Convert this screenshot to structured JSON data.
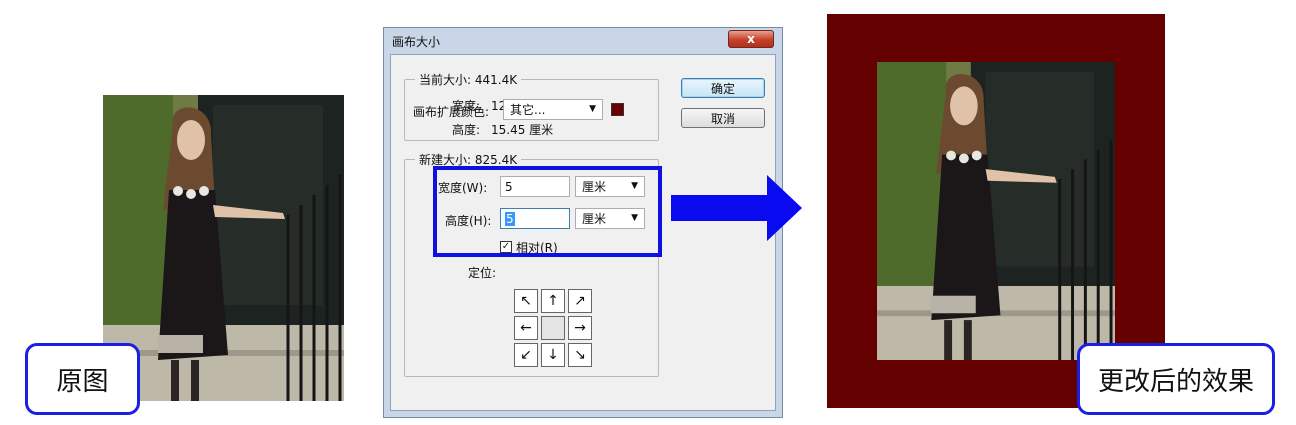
{
  "captions": {
    "original": "原图",
    "result": "更改后的效果"
  },
  "dialog": {
    "title": "画布大小",
    "close_symbol": "x",
    "current_size": {
      "legend": "当前大小: 441.4K",
      "width_label": "宽度:",
      "width_value": "12.14 厘米",
      "height_label": "高度:",
      "height_value": "15.45 厘米"
    },
    "new_size": {
      "legend": "新建大小: 825.4K",
      "width_label": "宽度(W):",
      "width_value": "5",
      "width_unit": "厘米",
      "height_label": "高度(H):",
      "height_value": "5",
      "height_unit": "厘米",
      "relative_label": "相对(R)",
      "relative_checked": true,
      "anchor_label": "定位:",
      "anchor_arrows": [
        "↖",
        "↑",
        "↗",
        "←",
        "",
        "→",
        "↙",
        "↓",
        "↘"
      ]
    },
    "buttons": {
      "ok": "确定",
      "cancel": "取消"
    },
    "extension_color": {
      "label": "画布扩展颜色:",
      "value": "其它...",
      "color": "#6b0000"
    },
    "dropdown_arrow": "▼"
  },
  "colors": {
    "highlight": "#1010e0",
    "arrow": "#0a0af0",
    "canvas_border": "#650000"
  }
}
